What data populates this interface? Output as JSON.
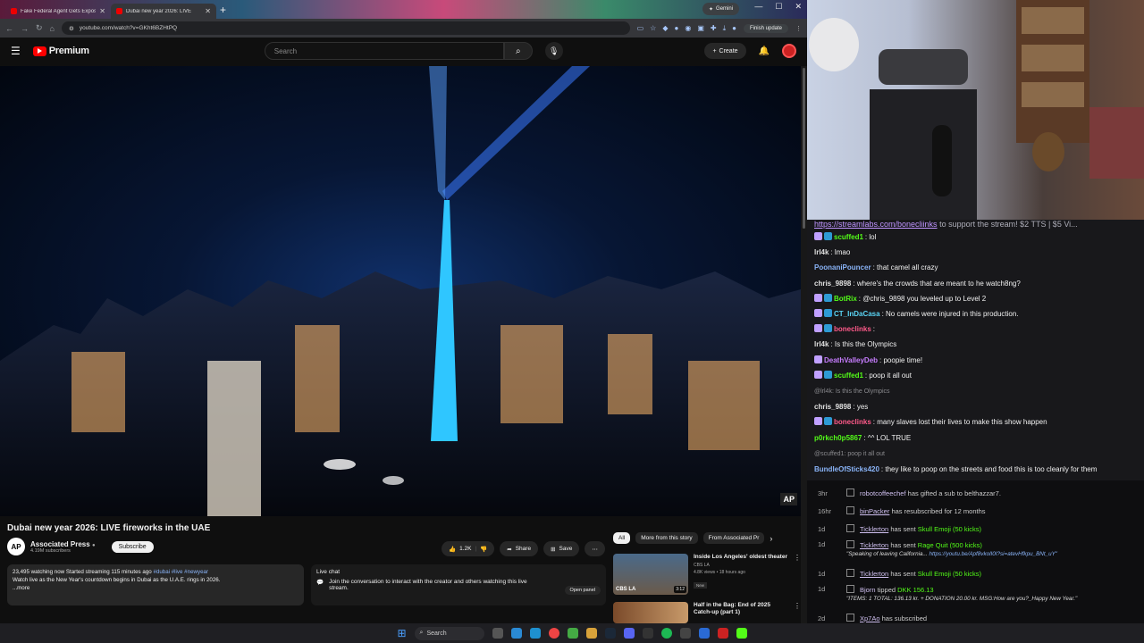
{
  "browser": {
    "tabs": [
      {
        "label": "Fake Federal Agent Gets Expos"
      },
      {
        "label": "Dubai new year 2026: LIVE"
      }
    ],
    "gemini_label": "Gemini",
    "url": "youtube.com/watch?v=GKht6BZHtPQ",
    "finish_update": "Finish update"
  },
  "youtube": {
    "logo_text": "Premium",
    "search_placeholder": "Search",
    "create_label": "Create",
    "video": {
      "watermark": "AP",
      "title": "Dubai new year 2026: LIVE fireworks in the UAE",
      "channel": "Associated Press",
      "channel_logo": "AP",
      "subscribers": "4.19M subscribers",
      "subscribe_label": "Subscribe",
      "likes": "1.2K",
      "share_label": "Share",
      "save_label": "Save",
      "stats": "23,495 watching now  Started streaming 115 minutes ago",
      "hashtags": "#dubai #live #newyear",
      "description": "Watch live as the New Year's countdown begins in Dubai as the U.A.E. rings in 2026.",
      "more": "...more"
    },
    "live_chat": {
      "title": "Live chat",
      "text": "Join the conversation to interact with the creator and others watching this live stream.",
      "open_panel": "Open panel"
    },
    "chips": [
      "All",
      "More from this story",
      "From Associated Pr"
    ],
    "recommendations": [
      {
        "title": "Inside Los Angeles' oldest theater",
        "channel": "CBS LA",
        "meta": "4.8K views • 18 hours ago",
        "badge": "New",
        "duration": "3:12",
        "thumb_label": "CBS LA"
      },
      {
        "title": "Half in the Bag: End of 2025 Catch-up (part 1)",
        "channel": "",
        "meta": "",
        "badge": "",
        "duration": "",
        "thumb_label": ""
      }
    ]
  },
  "chat": {
    "top_link": "https://streamlabs.com/bonecliinks",
    "top_text": "to support the stream! $2 TTS | $5 Vi...",
    "messages": [
      {
        "user": "scuffed1",
        "text": "lol",
        "color": "#53fc18",
        "badges": 2
      },
      {
        "user": "lrl4k",
        "text": "lmao",
        "color": "#e0e0e0",
        "badges": 0
      },
      {
        "user": "PoonaniPouncer",
        "text": "that camel all crazy",
        "color": "#8ab4f8",
        "badges": 0
      },
      {
        "user": "chris_9898",
        "text": "where's the crowds that are meant to he watch8ng?",
        "color": "#e0e0e0",
        "badges": 0
      },
      {
        "user": "BotRix",
        "text": "@chris_9898 you leveled up to Level 2",
        "color": "#53fc18",
        "badges": 2
      },
      {
        "user": "CT_InDaCasa",
        "text": "No camels were injured in this production.",
        "color": "#5ad5f5",
        "badges": 2
      },
      {
        "user": "boneclinks",
        "text": "",
        "color": "#ff5a8a",
        "badges": 2
      },
      {
        "user": "lrl4k",
        "text": "Is this the Olympics",
        "color": "#e0e0e0",
        "badges": 0
      },
      {
        "user": "DeathValleyDeb",
        "text": "poopie time!",
        "color": "#c77dff",
        "badges": 1
      },
      {
        "user": "scuffed1",
        "text": "poop it all out",
        "color": "#53fc18",
        "badges": 2
      },
      {
        "reply": "@lrl4k: Is this the Olympics"
      },
      {
        "user": "chris_9898",
        "text": "yes",
        "color": "#e0e0e0",
        "badges": 0
      },
      {
        "user": "boneclinks",
        "text": "many slaves lost their lives to make this show happen",
        "color": "#ff5a8a",
        "badges": 2
      },
      {
        "user": "p0rkch0p5867",
        "text": "^^ LOL TRUE",
        "color": "#53fc18",
        "badges": 0
      },
      {
        "reply": "@scuffed1: poop it all out"
      },
      {
        "user": "BundleOfSticks420",
        "text": "they like to poop on the streets and food this is too cleanly for them",
        "color": "#8ab4f8",
        "badges": 0
      }
    ]
  },
  "events": [
    {
      "time": "3hr",
      "name": "robotcoffeechef",
      "text": "has gifted a sub to",
      "target": "belthazzar7.",
      "underline": false
    },
    {
      "time": "16hr",
      "name": "binPacker",
      "text": "has resubscribed for 12 months",
      "target": "",
      "underline": true
    },
    {
      "time": "1d",
      "name": "Ticklerton",
      "text": "has sent",
      "target": "Skull Emoji (50 kicks)",
      "underline": true
    },
    {
      "time": "1d",
      "name": "Ticklerton",
      "text": "has sent",
      "target": "Rage Quit (500 kicks)",
      "underline": true,
      "sub": "\"Speaking of leaving California...",
      "sub_link": "https://youtu.be/Apf8vkolI0I?si=atevHfkpu_BNt_uY\""
    },
    {
      "time": "1d",
      "name": "Ticklerton",
      "text": "has sent",
      "target": "Skull Emoji (50 kicks)",
      "underline": true
    },
    {
      "time": "1d",
      "name": "Bjorn",
      "text": "tipped",
      "target": "DKK 156.13",
      "underline": false,
      "sub": "\"ITEMS: 1 TOTAL: 136.13 kr. + DONATION 20.00 kr. MSG:How are you?_Happy New Year.\"",
      "sub_link": ""
    },
    {
      "time": "2d",
      "name": "Xp7Ao",
      "text": "has subscribed",
      "target": "",
      "underline": true
    }
  ],
  "taskbar": {
    "search_label": "Search"
  }
}
